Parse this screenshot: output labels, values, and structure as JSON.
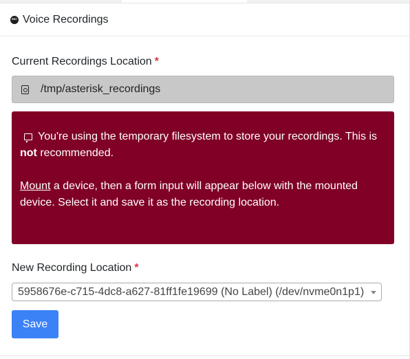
{
  "card": {
    "title": "Voice Recordings",
    "icon": "record-icon",
    "icon_text": "REC"
  },
  "current_location": {
    "label": "Current Recordings Location",
    "required_marker": "*",
    "icon": "hard-drive-icon",
    "value": "/tmp/asterisk_recordings"
  },
  "alert": {
    "icon": "message-icon",
    "line1_text": "You're using the temporary filesystem to store your recordings. This is",
    "line1_bold": "not",
    "line1_end": "recommended.",
    "line2_link": "Mount",
    "line2_text": "a device, then a form input will appear below with the mounted device. Select it and save it as the recording location.",
    "background_color": "#800026"
  },
  "new_location": {
    "label": "New Recording Location",
    "required_marker": "*",
    "selected_value": "5958676e-c715-4dc8-a627-81ff1fe19699 (No Label) (/dev/nvme0n1p1)"
  },
  "actions": {
    "save_label": "Save",
    "save_color": "#3b82f6"
  }
}
